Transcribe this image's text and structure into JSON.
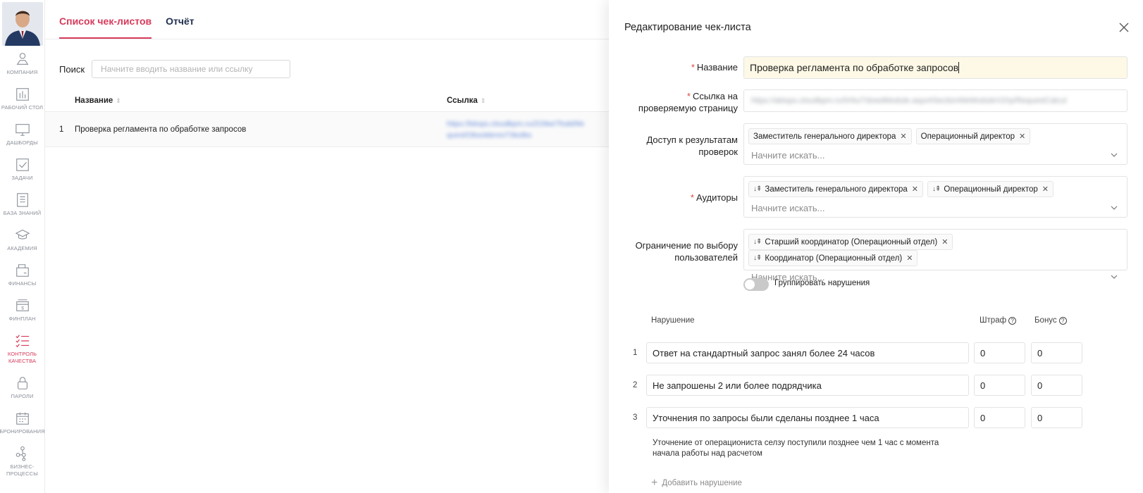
{
  "sidebar": {
    "items": [
      {
        "label": "КОМПАНИЯ",
        "icon": "company-icon"
      },
      {
        "label": "РАБОЧИЙ СТОЛ",
        "icon": "desktop-icon"
      },
      {
        "label": "ДАШБОРДЫ",
        "icon": "monitor-icon"
      },
      {
        "label": "ЗАДАЧИ",
        "icon": "tasks-icon"
      },
      {
        "label": "БАЗА ЗНАНИЙ",
        "icon": "knowledge-icon"
      },
      {
        "label": "АКАДЕМИЯ",
        "icon": "graduation-icon"
      },
      {
        "label": "ФИНАНСЫ",
        "icon": "finance-icon"
      },
      {
        "label": "ФИНПЛАН",
        "icon": "finplan-icon"
      },
      {
        "label": "КОНТРОЛЬ КАЧЕСТВА",
        "icon": "quality-icon",
        "active": true
      },
      {
        "label": "ПАРОЛИ",
        "icon": "lock-icon"
      },
      {
        "label": "БРОНИРОВАНИЯ",
        "icon": "calendar-icon"
      },
      {
        "label": "БИЗНЕС-ПРОЦЕССЫ",
        "icon": "process-icon"
      }
    ]
  },
  "main": {
    "tabs": [
      {
        "label": "Список чек-листов",
        "active": true
      },
      {
        "label": "Отчёт",
        "active": false
      }
    ],
    "search": {
      "label": "Поиск",
      "placeholder": "Начните вводить название или ссылку"
    },
    "table": {
      "columns": [
        "Название",
        "Ссылка"
      ],
      "rows": [
        {
          "num": "1",
          "name": "Проверка регламента по обработке запросов",
          "link": "https://bitops.cloudbpm.ru/ZO9w/7fodd/Module.aspx#AactionWeModule?ajax",
          "link2": "quest/ObsolderesTSkolbs"
        }
      ]
    }
  },
  "drawer": {
    "title": "Редактирование чек-листа",
    "fields": {
      "name_label": "Название",
      "name_value": "Проверка регламента по обработке запросов",
      "url_label_1": "Ссылка на",
      "url_label_2": "проверяемую страницу",
      "url_value": "https://abisps.cloudbpm.ru/0r9u/7dowdModule.aspx#SectionWeModuleV2/rp/RequestCalcul",
      "access_label_1": "Доступ к результатам",
      "access_label_2": "проверок",
      "access_tags": [
        "Заместитель генерального директора",
        "Операционный директор"
      ],
      "auditors_label": "Аудиторы",
      "auditors_tags": [
        "Заместитель генерального директора",
        "Операционный директор"
      ],
      "restrict_label_1": "Ограничение по выбору",
      "restrict_label_2": "пользователей",
      "restrict_tags": [
        "Старший координатор (Операционный отдел)",
        "Координатор (Операционный отдел)"
      ],
      "search_placeholder": "Начните искать..."
    },
    "group_toggle": {
      "label": "Группировать нарушения",
      "on": false
    },
    "violations": {
      "headers": {
        "violation": "Нарушение",
        "fine": "Штраф",
        "bonus": "Бонус"
      },
      "rows": [
        {
          "num": "1",
          "text": "Ответ на стандартный запрос занял более 24 часов",
          "fine": "0",
          "bonus": "0"
        },
        {
          "num": "2",
          "text": "Не запрошены 2 или более подрядчика",
          "fine": "0",
          "bonus": "0"
        },
        {
          "num": "3",
          "text": "Уточнения по запросы были сделаны позднее 1 часа",
          "fine": "0",
          "bonus": "0"
        }
      ],
      "desc_line1": "Уточнение от операциониста селзу поступили позднее чем 1 час с момента",
      "desc_line2": "начала работы над расчетом",
      "add_label": "Добавить нарушение"
    },
    "colors": {
      "accent": "#d63a5b",
      "required": "#e2453c",
      "name_bg": "#fdf9e6"
    }
  }
}
